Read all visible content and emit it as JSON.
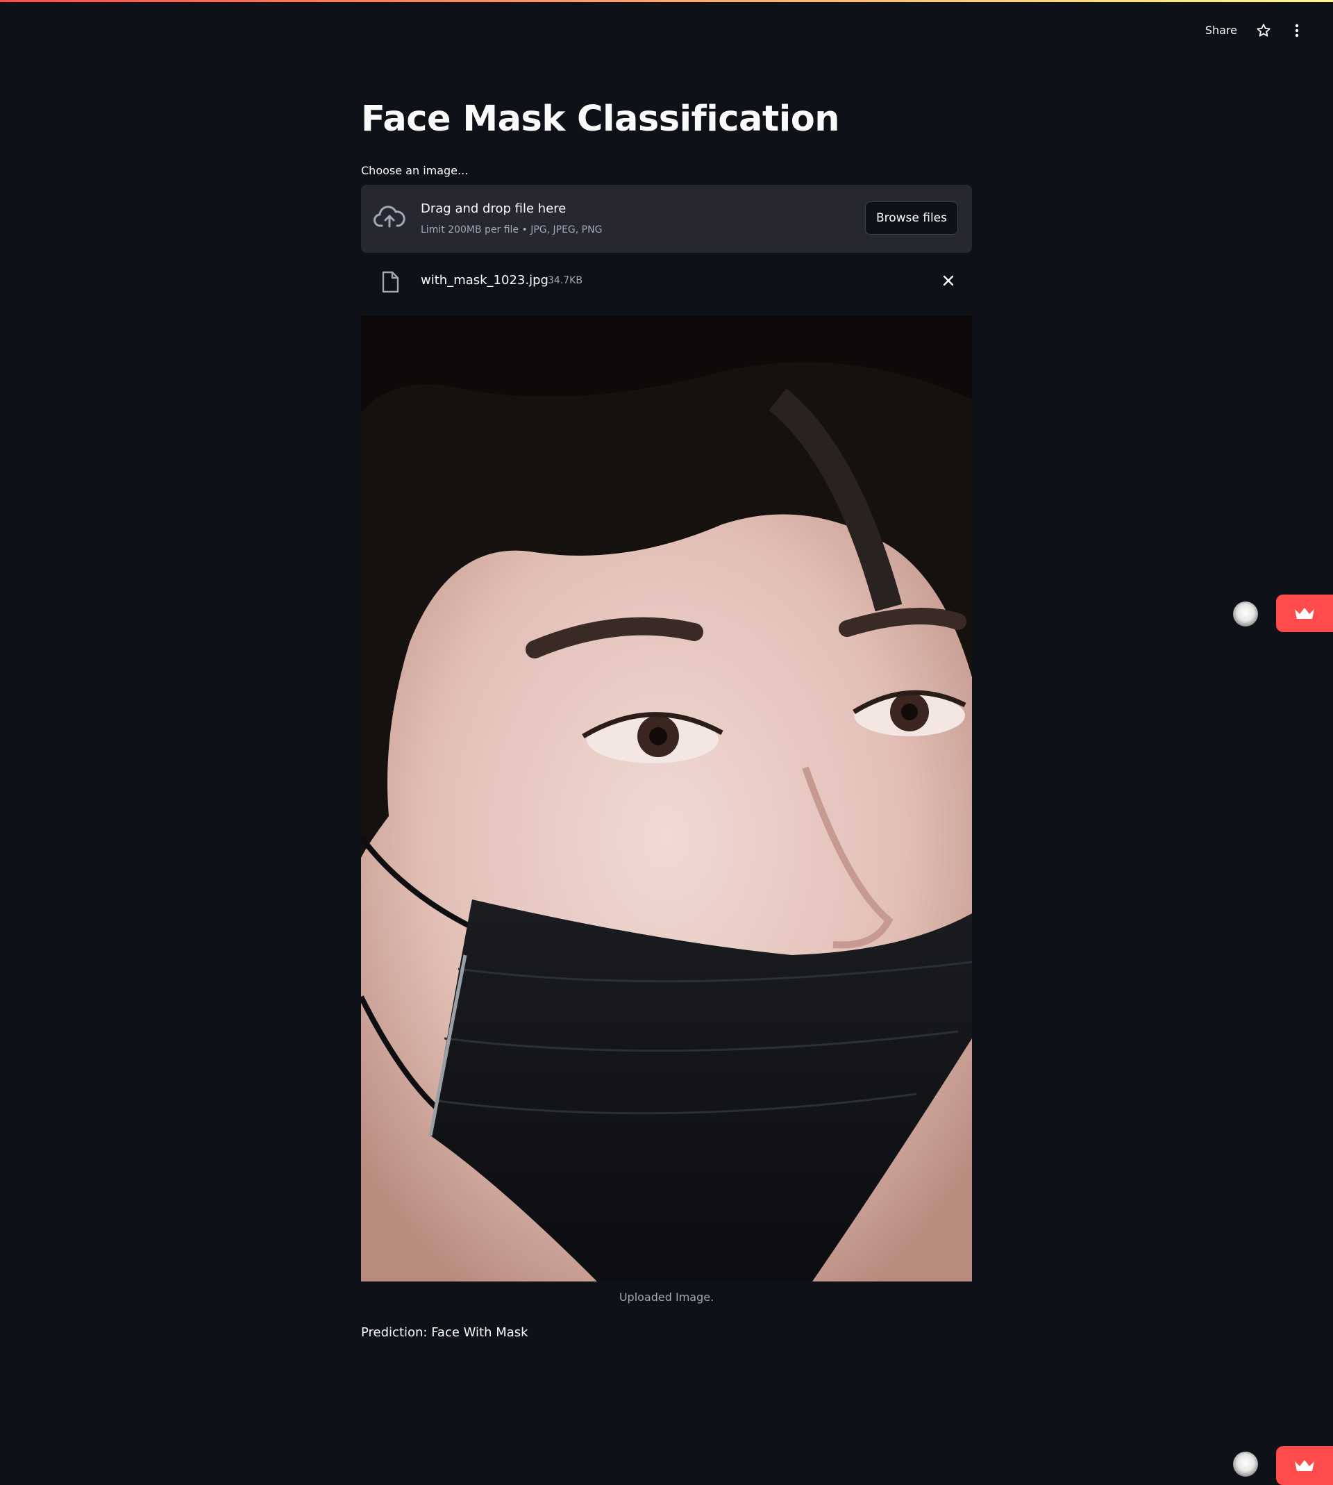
{
  "toolbar": {
    "share_label": "Share",
    "star_icon": "star-icon",
    "menu_icon": "kebab-menu-icon"
  },
  "main": {
    "title": "Face Mask Classification",
    "uploader": {
      "label": "Choose an image...",
      "dropzone_title": "Drag and drop file here",
      "dropzone_subtitle": "Limit 200MB per file • JPG, JPEG, PNG",
      "browse_label": "Browse files",
      "icon": "cloud-upload-icon"
    },
    "file": {
      "name": "with_mask_1023.jpg",
      "size": "34.7KB",
      "icon": "file-icon",
      "remove_icon": "close-icon"
    },
    "image_caption": "Uploaded Image.",
    "prediction": "Prediction: Face With Mask"
  },
  "colors": {
    "background": "#0e1117",
    "surface": "#262730",
    "accent": "#ff4b4b",
    "muted_text": "#a3a8b4"
  }
}
